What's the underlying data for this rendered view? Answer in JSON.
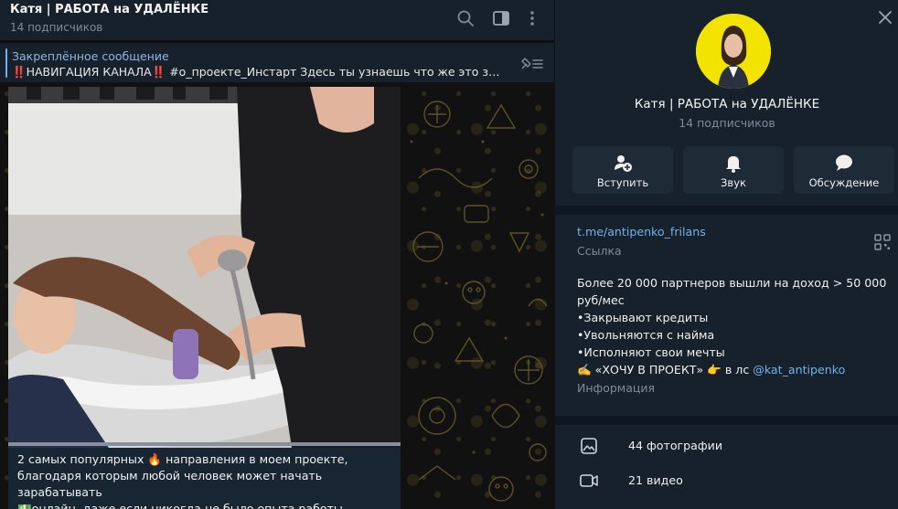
{
  "colors": {
    "header_bg": "#17212b",
    "accent": "#6ab2f2",
    "link": "#71b2ec",
    "muted": "#7e8b97",
    "avatar_bg": "#f3e400",
    "button_bg": "#1f2a37"
  },
  "chat": {
    "title": "Катя | РАБОТА на УДАЛЁНКЕ",
    "subtitle": "14 подписчиков",
    "header_icons": [
      "search-icon",
      "sidebar-toggle-icon",
      "more-vertical-icon"
    ],
    "pinned": {
      "title": "Закреплённое сообщение",
      "text": "‼️НАВИГАЦИЯ КАНАЛА‼️  #о_проекте_Инстарт Здесь ты узнаешь что же это за п...",
      "icon": "pin-list-icon"
    },
    "message": {
      "video_progress": 1.0,
      "caption_lines": [
        "2 самых популярных 🔥 направления в моем проекте,",
        "благодаря которым любой человек может начать зарабатывать",
        "💵онлайн, даже если никогда не было опыта работы"
      ]
    }
  },
  "info": {
    "close_icon": "close-icon",
    "name": "Катя | РАБОТА на УДАЛЁНКЕ",
    "subscribers": "14 подписчиков",
    "actions": [
      {
        "label": "Вступить",
        "icon": "add-user-icon"
      },
      {
        "label": "Звук",
        "icon": "bell-icon"
      },
      {
        "label": "Обсуждение",
        "icon": "chat-bubble-icon"
      }
    ],
    "link": "t.me/antipenko_frilans",
    "link_label": "Ссылка",
    "qr_icon": "qr-code-icon",
    "description": {
      "line1": "Более 20 000 партнеров вышли на доход > 50 000",
      "line2": "руб/мес",
      "line3": "•Закрывают кредиты",
      "line4": "•Увольняются с найма",
      "line5": "•Исполняют свои мечты",
      "line6_prefix": "✍️ «ХОЧУ В ПРОЕКТ» 👉 в лс ",
      "line6_mention": "@kat_antipenko"
    },
    "description_label": "Информация",
    "media": [
      {
        "label": "44 фотографии",
        "icon": "photo-icon"
      },
      {
        "label": "21 видео",
        "icon": "video-icon"
      }
    ]
  }
}
